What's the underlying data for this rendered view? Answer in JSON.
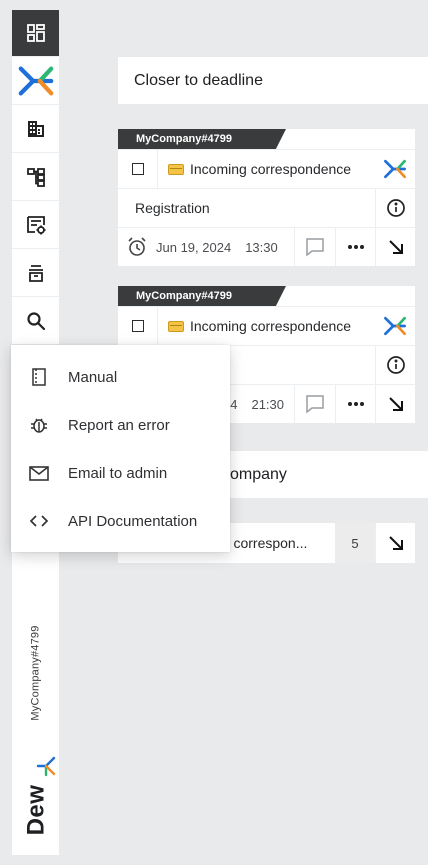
{
  "sidebar": {
    "items": [
      {
        "icon": "dashboard-icon",
        "active": true
      },
      {
        "icon": "dew-logo-icon"
      },
      {
        "icon": "building-icon"
      },
      {
        "icon": "org-structure-icon"
      },
      {
        "icon": "document-settings-icon"
      },
      {
        "icon": "archive-icon"
      },
      {
        "icon": "search-icon"
      }
    ],
    "company": "MyCompany#4799",
    "brand": "Dew"
  },
  "sections": {
    "deadline_title": "Closer to deadline",
    "company_title": "ompany"
  },
  "cards": [
    {
      "tag": "MyCompany#4799",
      "title": "Incoming correspondence",
      "stage": "Registration",
      "date": "Jun 19, 2024",
      "time": "13:30"
    },
    {
      "tag": "MyCompany#4799",
      "title": "Incoming correspondence",
      "date_partial": "24",
      "time": "21:30"
    }
  ],
  "company_row": {
    "title": "ng correspon...",
    "count": "5"
  },
  "menu": {
    "items": [
      {
        "label": "Manual",
        "icon": "manual-icon"
      },
      {
        "label": "Report an error",
        "icon": "bug-icon"
      },
      {
        "label": "Email to admin",
        "icon": "mail-icon"
      },
      {
        "label": "API Documentation",
        "icon": "code-icon"
      }
    ]
  },
  "colors": {
    "sidebar_active": "#3a3b3c",
    "brand_blue": "#1e6fd9",
    "brand_green": "#2bb673",
    "brand_orange": "#f28c28",
    "background": "#e9eaec"
  }
}
